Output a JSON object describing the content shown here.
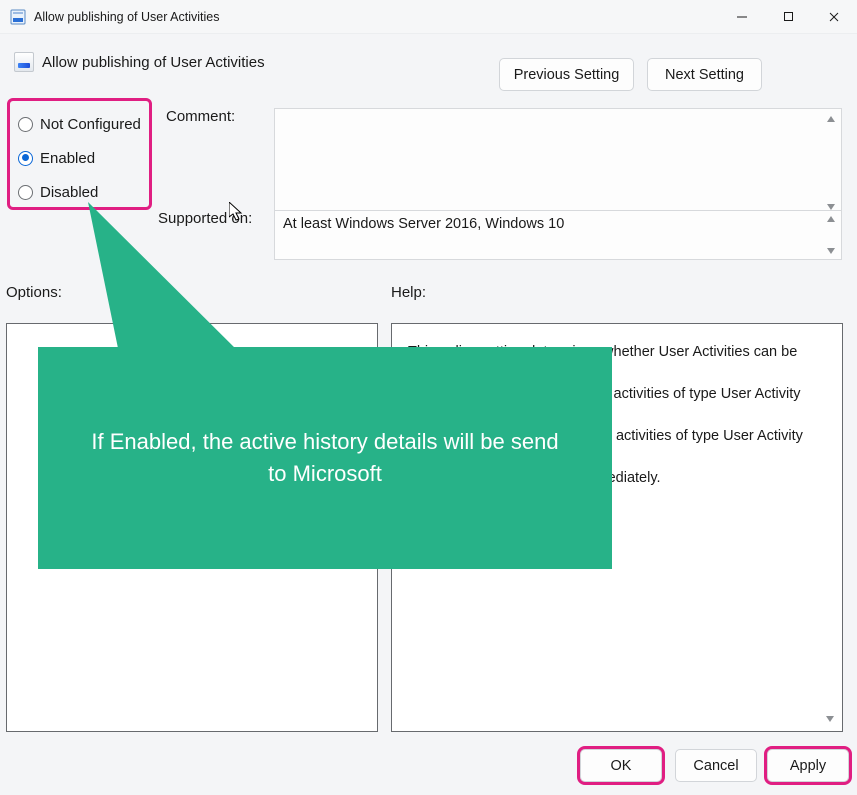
{
  "titlebar": {
    "title": "Allow publishing of User Activities"
  },
  "header": {
    "policy_title": "Allow publishing of User Activities",
    "prev": "Previous Setting",
    "next": "Next Setting"
  },
  "radios": {
    "not_configured": "Not Configured",
    "enabled": "Enabled",
    "disabled": "Disabled",
    "selected": "enabled"
  },
  "labels": {
    "comment": "Comment:",
    "supported_on": "Supported on:",
    "options": "Options:",
    "help": "Help:"
  },
  "supported_text": "At least Windows Server 2016, Windows 10",
  "help_text": {
    "l1": "This policy setting determines whether User Activities can be published.",
    "l2": "If you enable this policy setting, activities of type User Activity are allowed to be published.",
    "l3": "If you disable this policy setting, activities of type User Activity are not allowed to be published.",
    "l4": "Policy change takes effect immediately."
  },
  "callout": "If Enabled, the active history details will be send to Microsoft",
  "footer": {
    "ok": "OK",
    "cancel": "Cancel",
    "apply": "Apply"
  },
  "colors": {
    "accent": "#e01e82",
    "callout": "#27b288",
    "radio_on": "#0a66d6"
  }
}
